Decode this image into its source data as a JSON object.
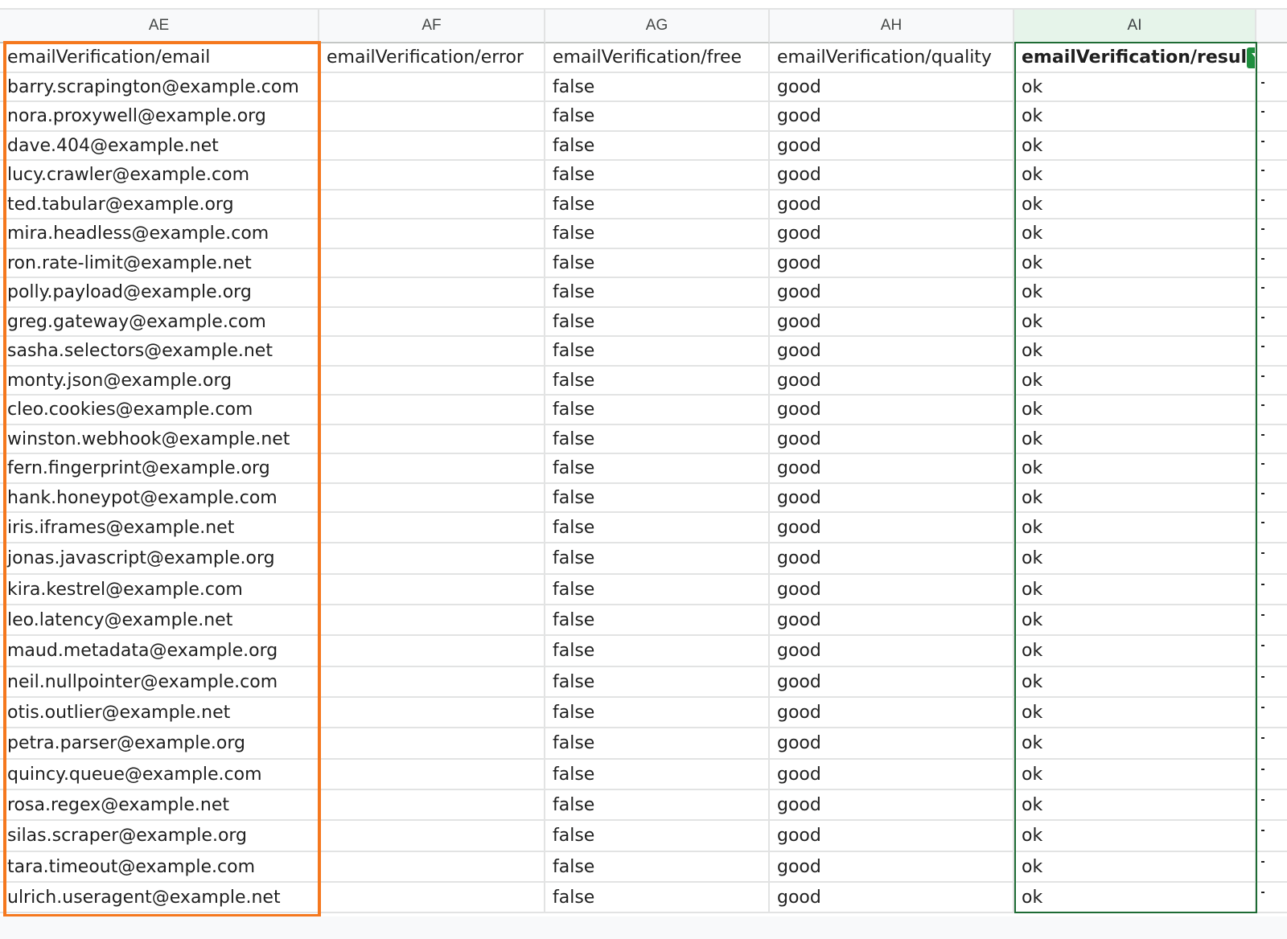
{
  "columns": [
    {
      "letter": "AE",
      "header": "emailVerification/email"
    },
    {
      "letter": "AF",
      "header": "emailVerification/error"
    },
    {
      "letter": "AG",
      "header": "emailVerification/free"
    },
    {
      "letter": "AH",
      "header": "emailVerification/quality"
    },
    {
      "letter": "AI",
      "header": "emailVerification/resul"
    }
  ],
  "rows": [
    {
      "email": "barry.scrapington@example.com",
      "error": "",
      "free": "false",
      "quality": "good",
      "result": "ok"
    },
    {
      "email": "nora.proxywell@example.org",
      "error": "",
      "free": "false",
      "quality": "good",
      "result": "ok"
    },
    {
      "email": "dave.404@example.net",
      "error": "",
      "free": "false",
      "quality": "good",
      "result": "ok"
    },
    {
      "email": "lucy.crawler@example.com",
      "error": "",
      "free": "false",
      "quality": "good",
      "result": "ok"
    },
    {
      "email": "ted.tabular@example.org",
      "error": "",
      "free": "false",
      "quality": "good",
      "result": "ok"
    },
    {
      "email": "mira.headless@example.com",
      "error": "",
      "free": "false",
      "quality": "good",
      "result": "ok"
    },
    {
      "email": "ron.rate-limit@example.net",
      "error": "",
      "free": "false",
      "quality": "good",
      "result": "ok"
    },
    {
      "email": "polly.payload@example.org",
      "error": "",
      "free": "false",
      "quality": "good",
      "result": "ok"
    },
    {
      "email": "greg.gateway@example.com",
      "error": "",
      "free": "false",
      "quality": "good",
      "result": "ok"
    },
    {
      "email": "sasha.selectors@example.net",
      "error": "",
      "free": "false",
      "quality": "good",
      "result": "ok"
    },
    {
      "email": "monty.json@example.org",
      "error": "",
      "free": "false",
      "quality": "good",
      "result": "ok"
    },
    {
      "email": "cleo.cookies@example.com",
      "error": "",
      "free": "false",
      "quality": "good",
      "result": "ok"
    },
    {
      "email": "winston.webhook@example.net",
      "error": "",
      "free": "false",
      "quality": "good",
      "result": "ok"
    },
    {
      "email": "fern.fingerprint@example.org",
      "error": "",
      "free": "false",
      "quality": "good",
      "result": "ok"
    },
    {
      "email": "hank.honeypot@example.com",
      "error": "",
      "free": "false",
      "quality": "good",
      "result": "ok"
    },
    {
      "email": "iris.iframes@example.net",
      "error": "",
      "free": "false",
      "quality": "good",
      "result": "ok"
    },
    {
      "email": "jonas.javascript@example.org",
      "error": "",
      "free": "false",
      "quality": "good",
      "result": "ok"
    },
    {
      "email": "kira.kestrel@example.com",
      "error": "",
      "free": "false",
      "quality": "good",
      "result": "ok"
    },
    {
      "email": "leo.latency@example.net",
      "error": "",
      "free": "false",
      "quality": "good",
      "result": "ok"
    },
    {
      "email": "maud.metadata@example.org",
      "error": "",
      "free": "false",
      "quality": "good",
      "result": "ok"
    },
    {
      "email": "neil.nullpointer@example.com",
      "error": "",
      "free": "false",
      "quality": "good",
      "result": "ok"
    },
    {
      "email": "otis.outlier@example.net",
      "error": "",
      "free": "false",
      "quality": "good",
      "result": "ok"
    },
    {
      "email": "petra.parser@example.org",
      "error": "",
      "free": "false",
      "quality": "good",
      "result": "ok"
    },
    {
      "email": "quincy.queue@example.com",
      "error": "",
      "free": "false",
      "quality": "good",
      "result": "ok"
    },
    {
      "email": "rosa.regex@example.net",
      "error": "",
      "free": "false",
      "quality": "good",
      "result": "ok"
    },
    {
      "email": "silas.scraper@example.org",
      "error": "",
      "free": "false",
      "quality": "good",
      "result": "ok"
    },
    {
      "email": "tara.timeout@example.com",
      "error": "",
      "free": "false",
      "quality": "good",
      "result": "ok"
    },
    {
      "email": "ulrich.useragent@example.net",
      "error": "",
      "free": "false",
      "quality": "good",
      "result": "ok"
    }
  ],
  "icons": {
    "filter": "filter-funnel-icon"
  },
  "colors": {
    "selection_orange": "#f5781e",
    "filter_green": "#1e8e3e",
    "selected_header_bg": "#e6f4ea",
    "selected_column_border": "#1e6b34"
  }
}
